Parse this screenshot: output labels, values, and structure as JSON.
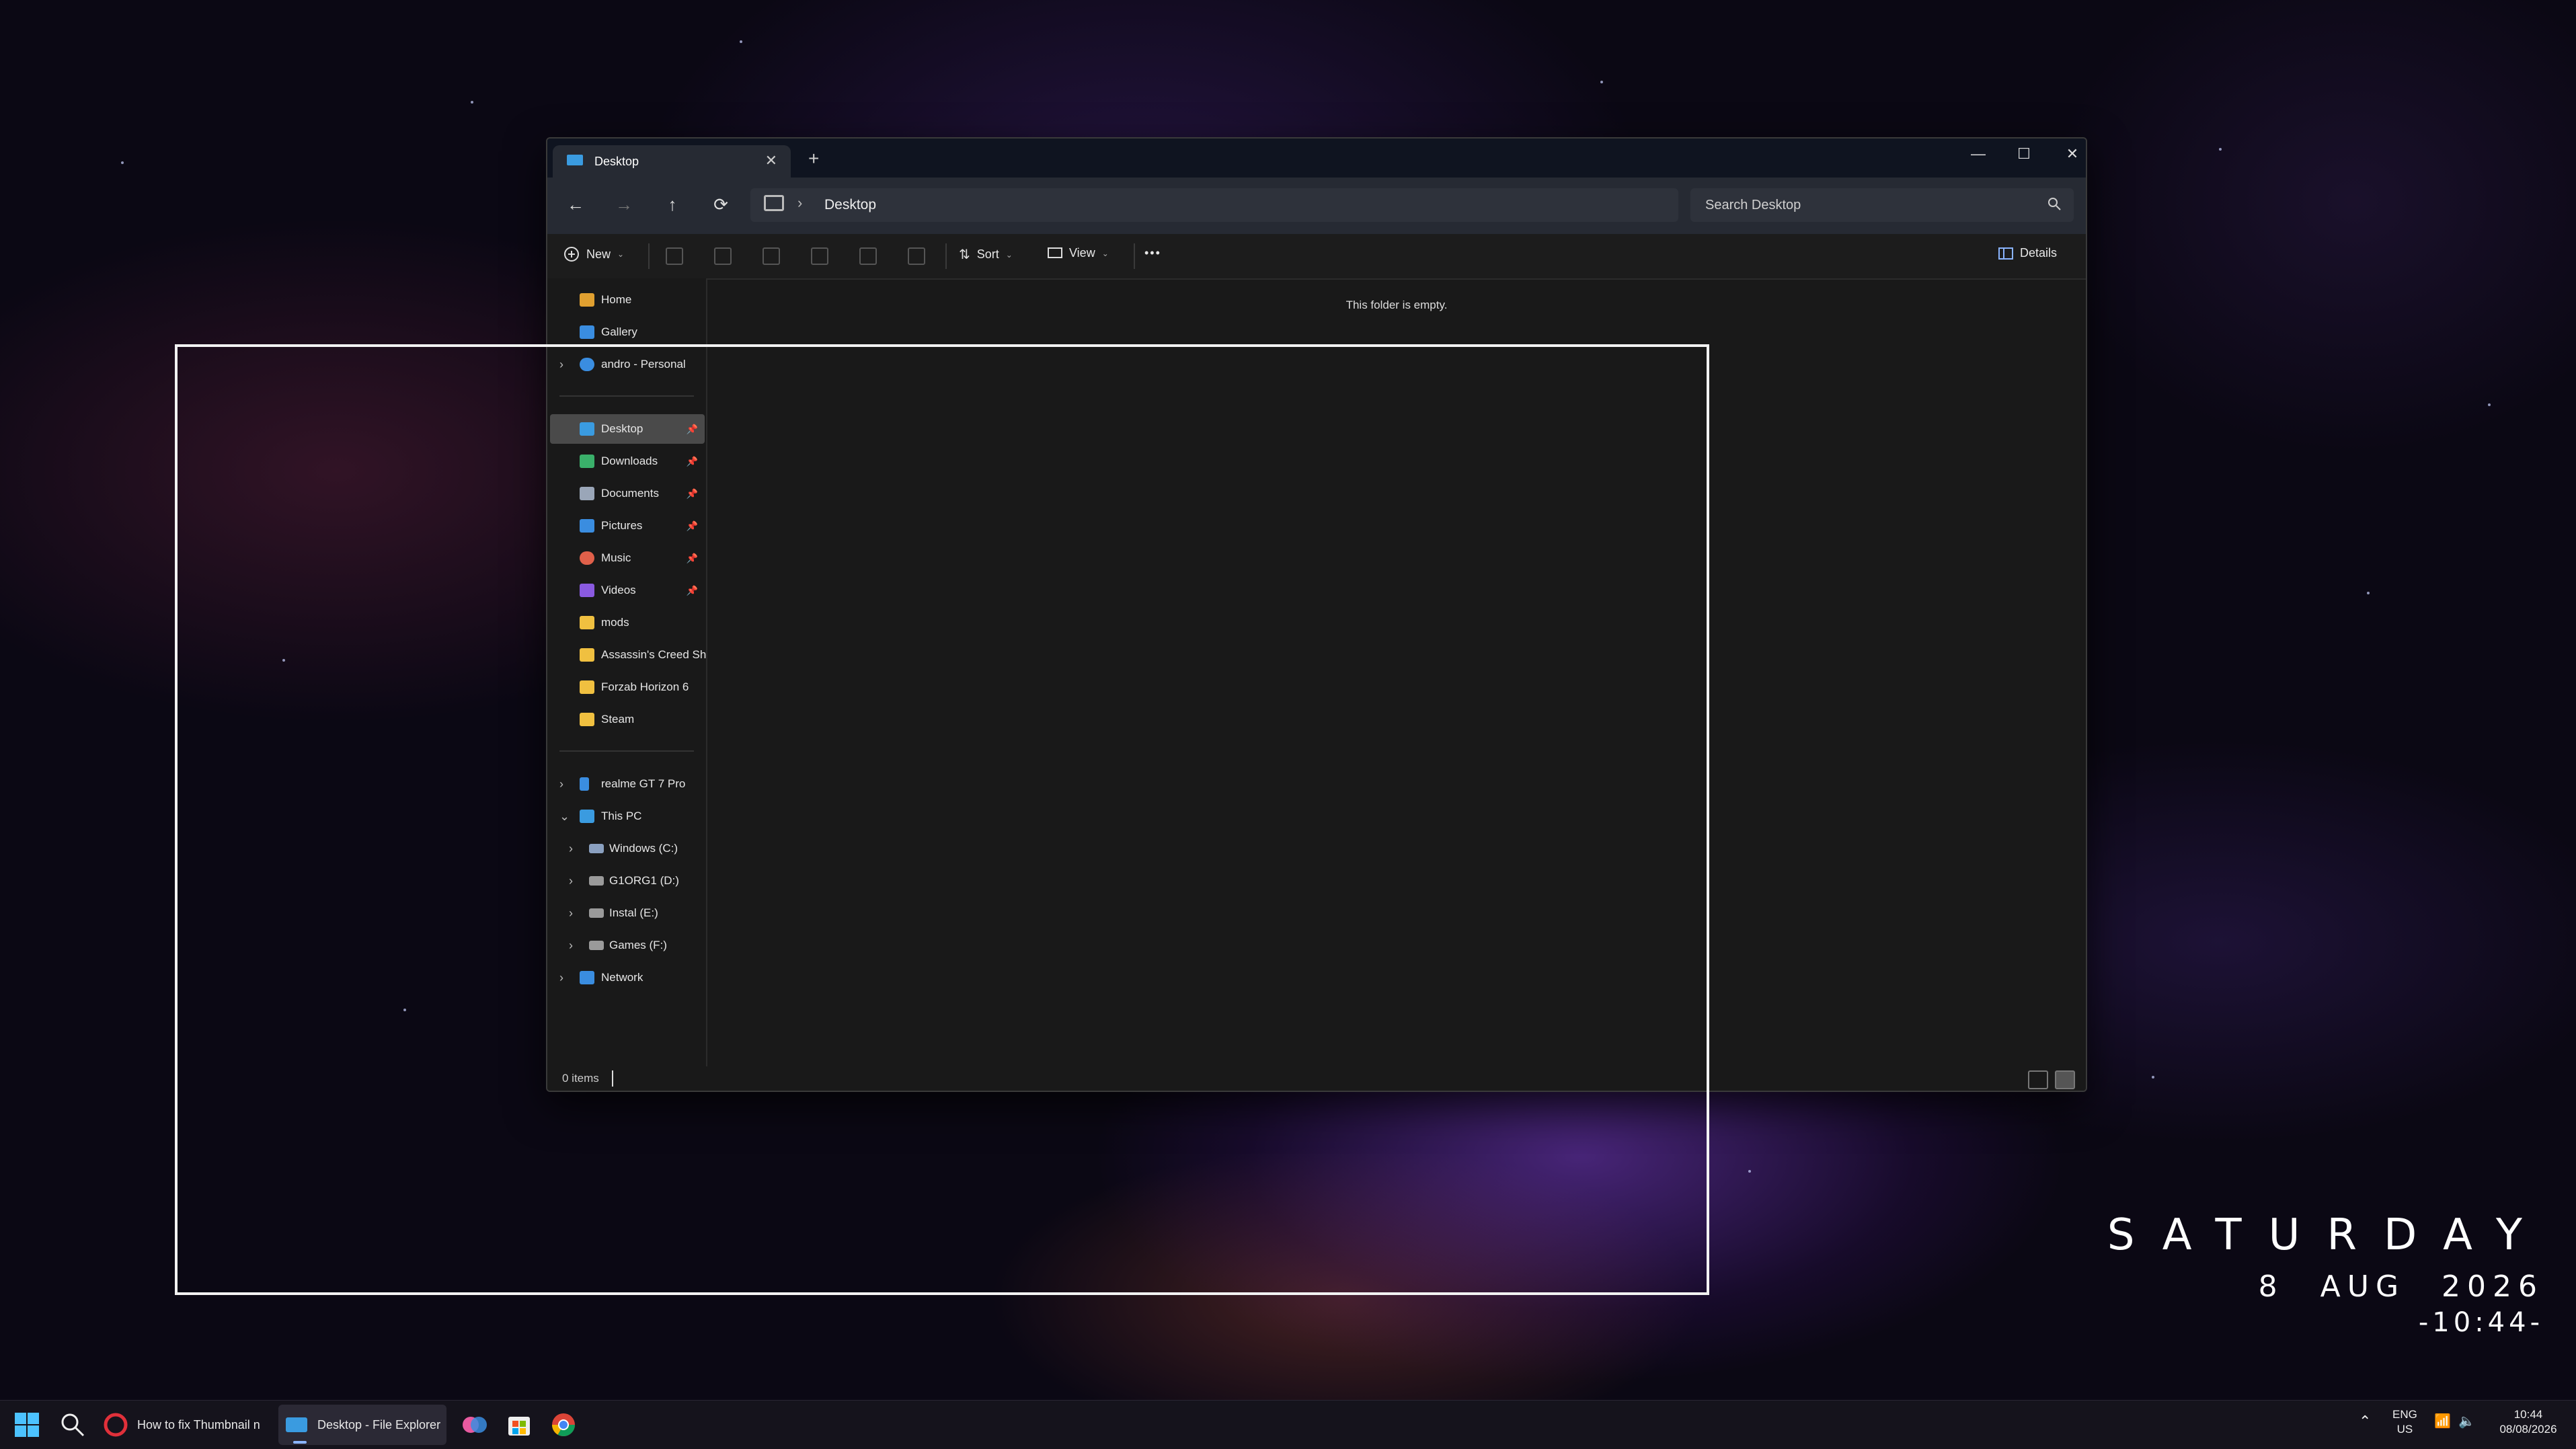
{
  "window": {
    "tab_title": "Desktop",
    "close_tab": "✕",
    "new_tab": "+",
    "minimize": "—",
    "maximize": "☐",
    "close": "✕"
  },
  "navigation": {
    "back": "←",
    "forward": "→",
    "up": "↑",
    "refresh": "⟳",
    "breadcrumb_separator": "›",
    "breadcrumb": "Desktop",
    "search_placeholder": "Search Desktop"
  },
  "commands": {
    "new": "New",
    "sort": "Sort",
    "view": "View",
    "more": "•••",
    "details": "Details"
  },
  "sidebar": {
    "quick": [
      {
        "label": "Home",
        "icon": "home-icon",
        "color": "#e0a030"
      },
      {
        "label": "Gallery",
        "icon": "gallery-icon",
        "color": "#3a8de0"
      },
      {
        "label": "andro - Personal",
        "icon": "onedrive-icon",
        "color": "#3a8de0",
        "expandable": true
      }
    ],
    "pinned": [
      {
        "label": "Desktop",
        "icon": "desktop-icon",
        "color": "#3a9be0",
        "pinned": true,
        "selected": true
      },
      {
        "label": "Downloads",
        "icon": "download-icon",
        "color": "#3ab06a",
        "pinned": true
      },
      {
        "label": "Documents",
        "icon": "document-icon",
        "color": "#9aa6b8",
        "pinned": true
      },
      {
        "label": "Pictures",
        "icon": "pictures-icon",
        "color": "#3a8de0",
        "pinned": true
      },
      {
        "label": "Music",
        "icon": "music-icon",
        "color": "#e0604a",
        "pinned": true
      },
      {
        "label": "Videos",
        "icon": "videos-icon",
        "color": "#8a5ae0",
        "pinned": true
      },
      {
        "label": "mods",
        "icon": "folder-icon",
        "color": "#f0c040"
      },
      {
        "label": "Assassin's Creed Sh",
        "icon": "folder-icon",
        "color": "#f0c040"
      },
      {
        "label": "Forzab Horizon 6",
        "icon": "folder-icon",
        "color": "#f0c040"
      },
      {
        "label": "Steam",
        "icon": "folder-icon",
        "color": "#f0c040"
      }
    ],
    "devices": [
      {
        "label": "realme GT 7 Pro",
        "icon": "phone-icon",
        "color": "#3a8de0",
        "expand": "›"
      },
      {
        "label": "This PC",
        "icon": "pc-icon",
        "color": "#3a9be0",
        "expand": "⌄"
      },
      {
        "label": "Windows (C:)",
        "icon": "drive-icon",
        "color": "#8aa0c0",
        "expand": "›",
        "indent": true
      },
      {
        "label": "G1ORG1 (D:)",
        "icon": "drive-icon",
        "color": "#9a9a9a",
        "expand": "›",
        "indent": true
      },
      {
        "label": "Instal (E:)",
        "icon": "drive-icon",
        "color": "#9a9a9a",
        "expand": "›",
        "indent": true
      },
      {
        "label": "Games (F:)",
        "icon": "drive-icon",
        "color": "#9a9a9a",
        "expand": "›",
        "indent": true
      },
      {
        "label": "Network",
        "icon": "network-icon",
        "color": "#3a8de0",
        "expand": "›"
      }
    ]
  },
  "content": {
    "empty_message": "This folder is empty."
  },
  "status": {
    "items": "0 items"
  },
  "widget": {
    "day": "SATURDAY",
    "date": "8 AUG 2026",
    "time": "-10:44-"
  },
  "taskbar": {
    "apps": [
      {
        "label": "How to fix Thumbnail n",
        "icon": "opera-icon"
      },
      {
        "label": "Desktop - File Explorer",
        "icon": "explorer-icon",
        "active": true
      }
    ],
    "tray": {
      "lang": "ENG",
      "region": "US",
      "time": "10:44",
      "date": "08/08/2026"
    }
  }
}
